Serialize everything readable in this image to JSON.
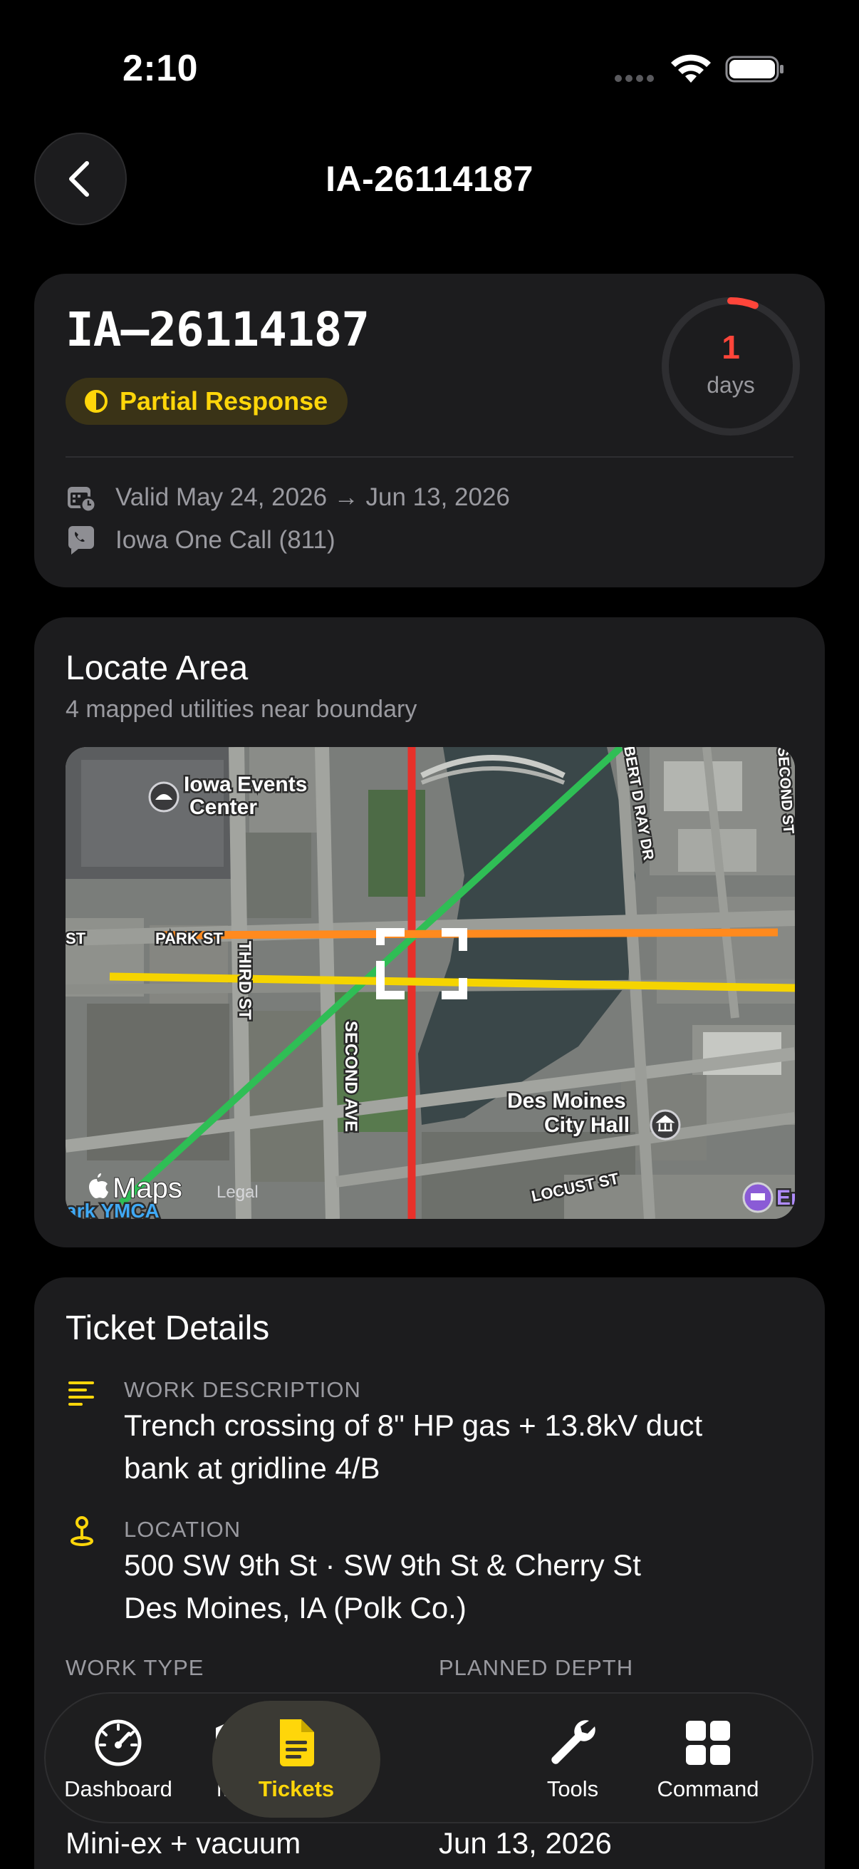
{
  "status_bar": {
    "time": "2:10"
  },
  "nav": {
    "title": "IA-26114187"
  },
  "ticket": {
    "number": "IA–26114187",
    "status": "Partial Response",
    "status_color": "#ffd60a",
    "countdown_value": "1",
    "countdown_unit": "days",
    "countdown_fraction": 0.06,
    "countdown_color": "#ff453a",
    "valid_text": "Valid May 24, 2026 → Jun 13, 2026",
    "source_text": "Iowa One Call (811)"
  },
  "locate_area": {
    "title": "Locate Area",
    "subtitle": "4 mapped utilities near boundary",
    "map_labels": {
      "poi_events": [
        "Iowa Events",
        "Center"
      ],
      "poi_city_hall": [
        "Des Moines",
        "City Hall"
      ],
      "park_st": "PARK ST",
      "st_left": "ST",
      "third_st": "THIRD ST",
      "second_ave": "SECOND AVE",
      "robert_d_ray": "BERT D RAY DR",
      "second_st": "SECOND ST",
      "locust_st": "LOCUST ST",
      "ymca": "ark YMCA",
      "maps_brand": "Maps",
      "legal": "Legal",
      "edge_label": "Er"
    },
    "utility_colors": {
      "electric": "#e8302a",
      "gas": "#f5d400",
      "telecom": "#ff8a1e",
      "water": "#2fbe55"
    }
  },
  "details": {
    "title": "Ticket Details",
    "work_description_label": "WORK DESCRIPTION",
    "work_description_line1": "Trench crossing of 8\" HP gas + 13.8kV duct",
    "work_description_line2": "bank at gridline 4/B",
    "location_label": "LOCATION",
    "location_line1": "500 SW 9th St · SW 9th St & Cherry St",
    "location_line2": "Des Moines, IA (Polk Co.)",
    "work_type_label": "WORK TYPE",
    "planned_depth_label": "PLANNED DEPTH",
    "equipment_value": "Mini-ex + vacuum",
    "date_value": "Jun 13, 2026"
  },
  "tab_bar": {
    "active": "Tickets",
    "accent": "#ffd60a",
    "tabs": [
      {
        "label": "Dashboard",
        "icon": "gauge-icon"
      },
      {
        "label": "Map",
        "icon": "map-icon"
      },
      {
        "label": "Tickets",
        "icon": "document-icon"
      },
      {
        "label": "Tools",
        "icon": "wrench-icon"
      },
      {
        "label": "Command",
        "icon": "grid-icon"
      }
    ]
  }
}
